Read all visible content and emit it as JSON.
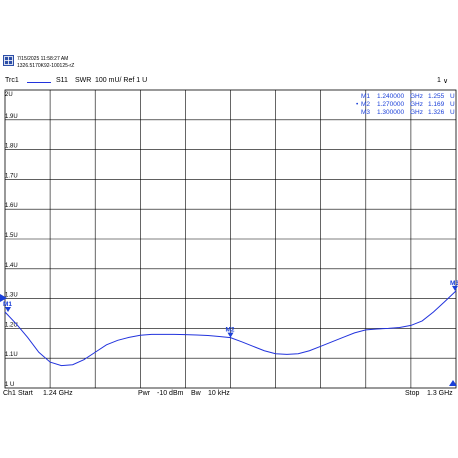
{
  "header": {
    "datetime": "7/15/2025 11:58:27 AM",
    "instrument_id": "1326.5170K92-100125-rZ"
  },
  "trace_row": {
    "trace": "Trc1",
    "param": "S11",
    "format": "SWR",
    "scale": "100 mU/ Ref 1 U",
    "channel_badge": "1",
    "badge_symbol": "∨"
  },
  "markers": [
    {
      "label": "M1",
      "freq": "1.240000",
      "freq_unit": "GHz",
      "value": "1.255",
      "value_unit": "U",
      "active": false
    },
    {
      "label": "M2",
      "freq": "1.270000",
      "freq_unit": "GHz",
      "value": "1.169",
      "value_unit": "U",
      "active": true
    },
    {
      "label": "M3",
      "freq": "1.300000",
      "freq_unit": "GHz",
      "value": "1.326",
      "value_unit": "U",
      "active": false
    }
  ],
  "footer": {
    "channel": "Ch1",
    "start_label": "Start",
    "start_value": "1.24 GHz",
    "pwr_label": "Pwr",
    "pwr_value": "-10 dBm",
    "bw_label": "Bw",
    "bw_value": "10 kHz",
    "stop_label": "Stop",
    "stop_value": "1.3 GHz"
  },
  "colors": {
    "trace": "#2233dd",
    "marker": "#1a3fd8",
    "grid": "#000000"
  },
  "chart_data": {
    "type": "line",
    "x_unit": "GHz",
    "y_unit": "U",
    "xlim": [
      1.24,
      1.3
    ],
    "ylim": [
      1.0,
      2.0
    ],
    "x_divisions": 10,
    "y_ticks": [
      "2U",
      "1.9U",
      "1.8U",
      "1.7U",
      "1.6U",
      "1.5U",
      "1.4U",
      "1.3U",
      "1.2U",
      "1.1U",
      "1 U"
    ],
    "grid": true,
    "series": [
      {
        "x": [
          1.24,
          1.2415,
          1.243,
          1.2445,
          1.246,
          1.2475,
          1.249,
          1.2505,
          1.252,
          1.2535,
          1.255,
          1.2565,
          1.258,
          1.2595,
          1.261,
          1.2625,
          1.264,
          1.2655,
          1.267,
          1.2685,
          1.27,
          1.2715,
          1.273,
          1.2745,
          1.276,
          1.2775,
          1.279,
          1.2805,
          1.282,
          1.2835,
          1.285,
          1.2865,
          1.288,
          1.2895,
          1.291,
          1.2925,
          1.294,
          1.2955,
          1.297,
          1.2985,
          1.3
        ],
        "y": [
          1.255,
          1.215,
          1.17,
          1.12,
          1.087,
          1.075,
          1.078,
          1.095,
          1.12,
          1.145,
          1.16,
          1.17,
          1.177,
          1.18,
          1.18,
          1.18,
          1.179,
          1.178,
          1.176,
          1.173,
          1.169,
          1.155,
          1.14,
          1.125,
          1.115,
          1.113,
          1.115,
          1.125,
          1.14,
          1.155,
          1.17,
          1.185,
          1.195,
          1.198,
          1.2,
          1.203,
          1.21,
          1.225,
          1.255,
          1.29,
          1.326
        ]
      }
    ],
    "marker_points": [
      {
        "label": "M1",
        "x": 1.24,
        "y": 1.255
      },
      {
        "label": "M2",
        "x": 1.27,
        "y": 1.169
      },
      {
        "label": "M3",
        "x": 1.3,
        "y": 1.326
      }
    ]
  }
}
